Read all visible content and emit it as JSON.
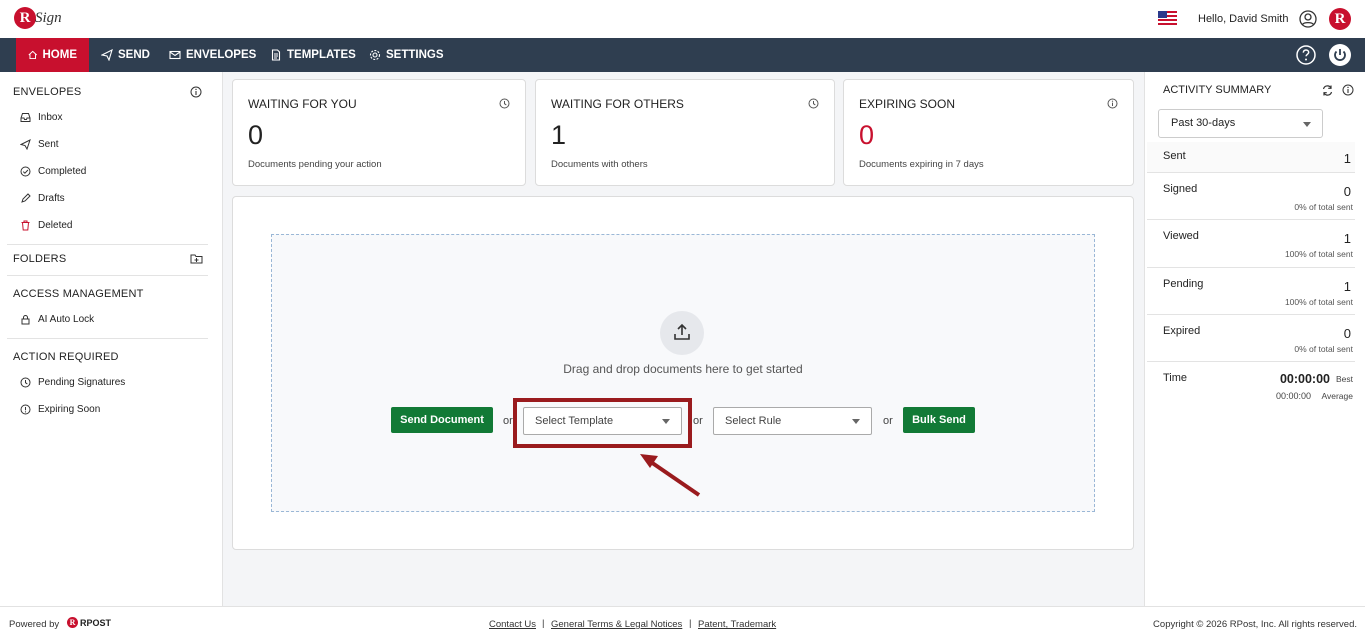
{
  "header": {
    "logo_text": "RSign",
    "greeting": "Hello, David Smith"
  },
  "nav": {
    "items": [
      {
        "label": "HOME",
        "icon": "home-icon",
        "active": true
      },
      {
        "label": "SEND",
        "icon": "send-icon"
      },
      {
        "label": "ENVELOPES",
        "icon": "envelope-icon"
      },
      {
        "label": "TEMPLATES",
        "icon": "template-icon"
      },
      {
        "label": "SETTINGS",
        "icon": "gear-icon"
      }
    ]
  },
  "sidebar": {
    "envelopes_heading": "ENVELOPES",
    "envelopes": [
      {
        "label": "Inbox",
        "icon": "inbox-icon"
      },
      {
        "label": "Sent",
        "icon": "send-icon"
      },
      {
        "label": "Completed",
        "icon": "check-circle-icon"
      },
      {
        "label": "Drafts",
        "icon": "draft-icon"
      },
      {
        "label": "Deleted",
        "icon": "trash-icon"
      }
    ],
    "folders_heading": "FOLDERS",
    "access_heading": "ACCESS MANAGEMENT",
    "access_items": [
      {
        "label": "AI Auto Lock",
        "icon": "lock-icon"
      }
    ],
    "action_heading": "ACTION REQUIRED",
    "action_items": [
      {
        "label": "Pending Signatures",
        "icon": "clock-icon"
      },
      {
        "label": "Expiring Soon",
        "icon": "alert-icon"
      }
    ]
  },
  "cards": [
    {
      "title": "WAITING FOR YOU",
      "value": "0",
      "subtitle": "Documents pending your action"
    },
    {
      "title": "WAITING FOR OTHERS",
      "value": "1",
      "subtitle": "Documents with others"
    },
    {
      "title": "EXPIRING SOON",
      "value": "0",
      "subtitle": "Documents expiring in 7 days",
      "value_color": "#c8102e"
    }
  ],
  "dropzone": {
    "text": "Drag and drop documents here to get started",
    "send_button": "Send Document",
    "or_label": "or",
    "template_placeholder": "Select Template",
    "rule_placeholder": "Select Rule",
    "bulk_button": "Bulk Send"
  },
  "activity": {
    "title": "ACTIVITY SUMMARY",
    "period": "Past 30-days",
    "stats": [
      {
        "label": "Sent",
        "value": "1",
        "pct": ""
      },
      {
        "label": "Signed",
        "value": "0",
        "pct": "0% of total sent"
      },
      {
        "label": "Viewed",
        "value": "1",
        "pct": "100% of total sent"
      },
      {
        "label": "Pending",
        "value": "1",
        "pct": "100% of total sent"
      },
      {
        "label": "Expired",
        "value": "0",
        "pct": "0% of total sent"
      }
    ],
    "time_label": "Time",
    "time_best": "00:00:00",
    "time_best_label": "Best",
    "time_avg": "00:00:00",
    "time_avg_label": "Average"
  },
  "footer": {
    "powered_by": "Powered by",
    "rpost": "RPOST",
    "links": [
      "Contact Us",
      "General Terms & Legal Notices",
      "Patent, Trademark"
    ],
    "separator": "|",
    "copyright": "Copyright © 2026 RPost, Inc. All rights reserved."
  },
  "colors": {
    "brand": "#c8102e",
    "nav_bg": "#2f3e50",
    "button_green": "#127a36",
    "highlight": "#9a1b1e"
  }
}
